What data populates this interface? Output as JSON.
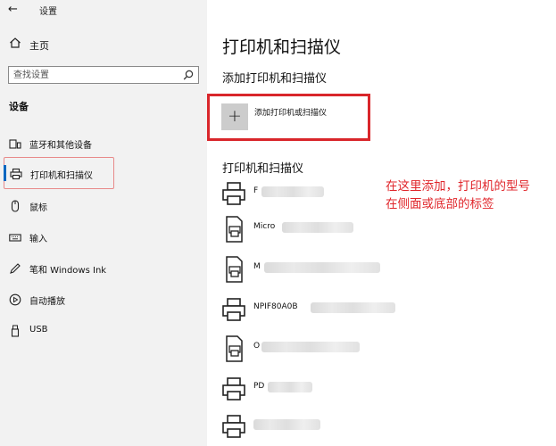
{
  "app": {
    "title": "设置"
  },
  "sidebar": {
    "home_label": "主页",
    "search_placeholder": "查找设置",
    "section_title": "设备",
    "items": [
      {
        "label": "蓝牙和其他设备",
        "icon": "bluetooth-devices-icon"
      },
      {
        "label": "打印机和扫描仪",
        "icon": "printer-icon",
        "selected": true
      },
      {
        "label": "鼠标",
        "icon": "mouse-icon"
      },
      {
        "label": "输入",
        "icon": "keyboard-icon"
      },
      {
        "label": "笔和 Windows Ink",
        "icon": "pen-icon"
      },
      {
        "label": "自动播放",
        "icon": "autoplay-icon"
      },
      {
        "label": "USB",
        "icon": "usb-icon"
      }
    ]
  },
  "main": {
    "title": "打印机和扫描仪",
    "add_section_heading": "添加打印机和扫描仪",
    "add_button_label": "添加打印机或扫描仪",
    "list_heading": "打印机和扫描仪",
    "printers": [
      {
        "name": "F",
        "icon": "printer-icon"
      },
      {
        "name": "Micro",
        "icon": "document-printer-icon"
      },
      {
        "name": "M",
        "icon": "document-printer-icon"
      },
      {
        "name": "NPIF80A0B",
        "icon": "printer-icon"
      },
      {
        "name": "O",
        "icon": "document-printer-icon"
      },
      {
        "name": "PD",
        "icon": "printer-icon"
      },
      {
        "name": "",
        "icon": "printer-icon"
      }
    ]
  },
  "annotation": {
    "text": "在这里添加，打印机的型号在侧面或底部的标签"
  },
  "colors": {
    "highlight_border": "#d9262b",
    "annotation_text": "#e0262b",
    "accent": "#0067c0",
    "sidebar_bg": "#f2f2f2"
  }
}
